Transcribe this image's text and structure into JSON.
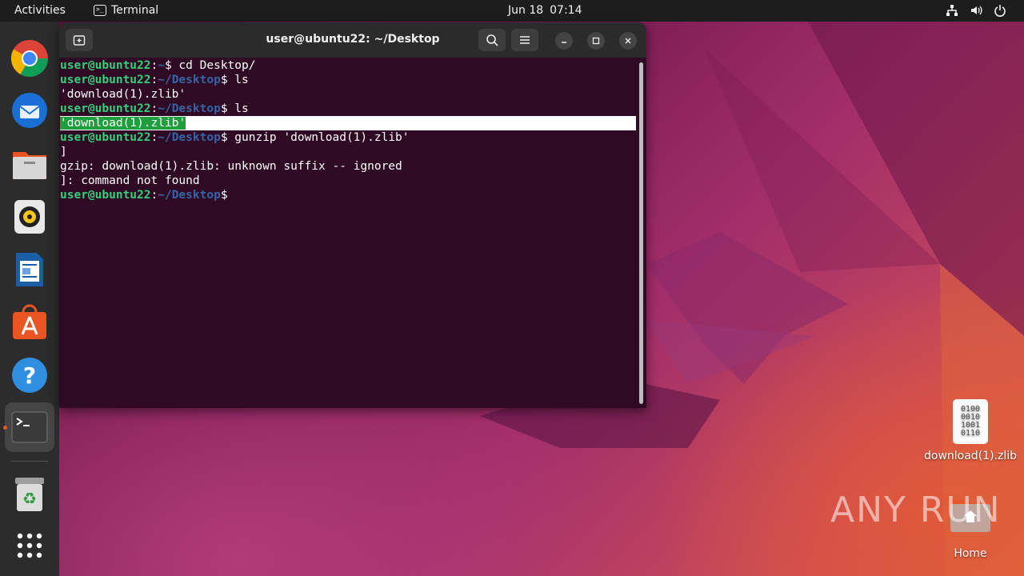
{
  "topbar": {
    "activities": "Activities",
    "app_name": "Terminal",
    "date": "Jun 18",
    "time": "07:14",
    "tray_icons": [
      "network-icon",
      "volume-icon",
      "power-icon"
    ]
  },
  "dock": {
    "items": [
      "chrome-icon",
      "thunderbird-icon",
      "files-icon",
      "rhythmbox-icon",
      "writer-icon",
      "app-center-icon",
      "help-icon",
      "terminal-icon",
      "trash-icon",
      "show-apps-icon"
    ],
    "active_item": "terminal-icon"
  },
  "terminal": {
    "title": "user@ubuntu22: ~/Desktop",
    "prompt_user": "user@ubuntu22",
    "lines": [
      {
        "type": "cmd",
        "path": "~",
        "cmd": " cd Desktop/"
      },
      {
        "type": "cmd",
        "path": "~/Desktop",
        "cmd": " ls"
      },
      {
        "type": "out",
        "text": "'download(1).zlib'"
      },
      {
        "type": "cmd",
        "path": "~/Desktop",
        "cmd": " ls"
      },
      {
        "type": "hl",
        "text": "'download(1).zlib'"
      },
      {
        "type": "cmd",
        "path": "~/Desktop",
        "cmd": " gunzip 'download(1).zlib'"
      },
      {
        "type": "out",
        "text": "]"
      },
      {
        "type": "out",
        "text": "gzip: download(1).zlib: unknown suffix -- ignored"
      },
      {
        "type": "out",
        "text": "]: command not found"
      },
      {
        "type": "cmd",
        "path": "~/Desktop",
        "cmd": ""
      }
    ]
  },
  "desktop": {
    "file_label": "download(1).zlib",
    "file_glyph": [
      "0100",
      "0010",
      "1001",
      "0110"
    ],
    "home_label": "Home",
    "watermark": "ANY RUN"
  },
  "colors": {
    "terminal_bg": "#300a24",
    "prompt_green": "#33d17a",
    "path_blue": "#3465a4",
    "highlight_green": "#1e9e3c",
    "accent": "#e95420"
  }
}
